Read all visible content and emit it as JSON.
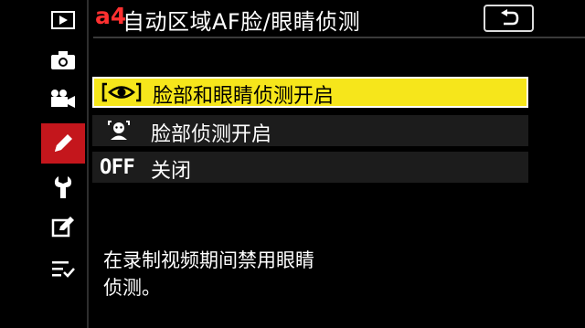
{
  "sidebar": {
    "items": [
      {
        "icon": "playback-icon"
      },
      {
        "icon": "camera-icon"
      },
      {
        "icon": "movie-camera-icon"
      },
      {
        "icon": "pencil-icon",
        "active": true
      },
      {
        "icon": "wrench-icon"
      },
      {
        "icon": "retouch-icon"
      },
      {
        "icon": "my-menu-icon"
      }
    ]
  },
  "header": {
    "code": "a4",
    "title": "自动区域AF脸/眼睛侦测"
  },
  "options": [
    {
      "label": "脸部和眼睛侦测开启",
      "selected": true
    },
    {
      "label": "脸部侦测开启",
      "selected": false
    },
    {
      "code": "OFF",
      "label": "关闭",
      "selected": false
    }
  ],
  "help_text": {
    "line1": "在录制视频期间禁用眼睛",
    "line2": "侦测。"
  },
  "colors": {
    "accent_red": "#c4161c",
    "selected_yellow": "#f6e61b",
    "option_bg": "#1c1c1c"
  }
}
